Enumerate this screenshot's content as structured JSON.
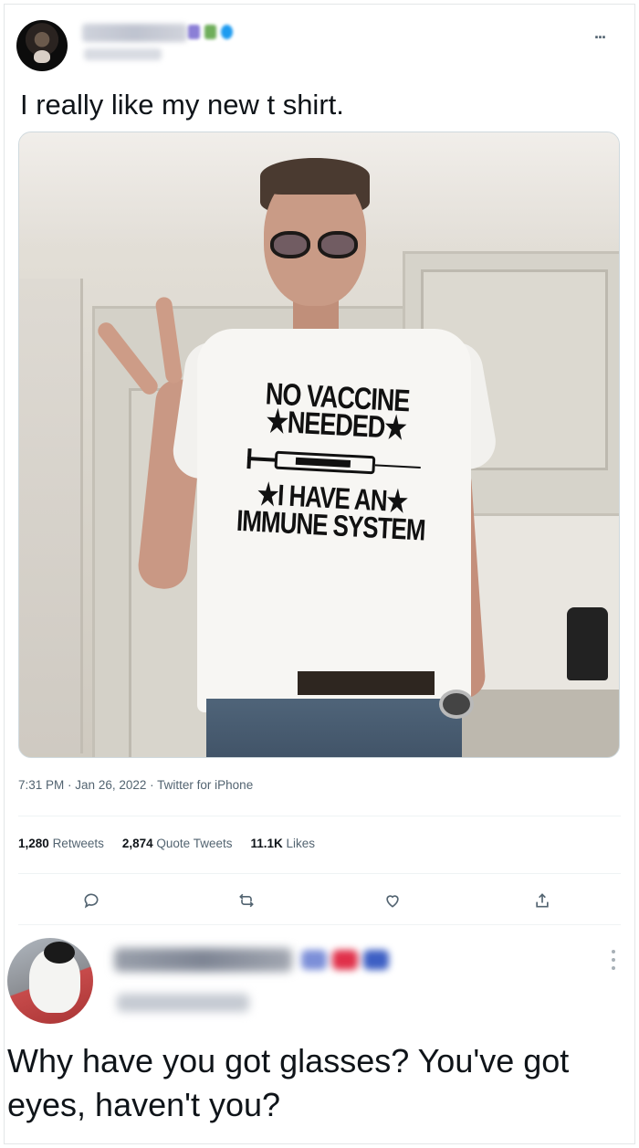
{
  "tweet": {
    "text": "I really like my new t shirt.",
    "more_label": "...",
    "photo": {
      "shirt_line1": "NO VACCINE",
      "shirt_line2": "★NEEDED★",
      "shirt_line3": "★I HAVE AN★",
      "shirt_line4": "IMMUNE SYSTEM"
    },
    "meta": {
      "time": "7:31 PM",
      "date": "Jan 26, 2022",
      "source": "Twitter for iPhone"
    },
    "stats": {
      "retweets_count": "1,280",
      "retweets_label": "Retweets",
      "quotes_count": "2,874",
      "quotes_label": "Quote Tweets",
      "likes_count": "11.1K",
      "likes_label": "Likes"
    },
    "actions": [
      "reply-icon",
      "retweet-icon",
      "like-icon",
      "share-icon"
    ]
  },
  "reply": {
    "text": "Why have you got glasses? You've got eyes, haven't you?"
  },
  "colors": {
    "text_primary": "#0f1419",
    "text_secondary": "#536471",
    "divider": "#eff3f4",
    "badge_purple": "#8b7fd6",
    "badge_green": "#6fae5b",
    "badge_blue": "#1d9bf0",
    "flag_red": "#e0304a"
  }
}
